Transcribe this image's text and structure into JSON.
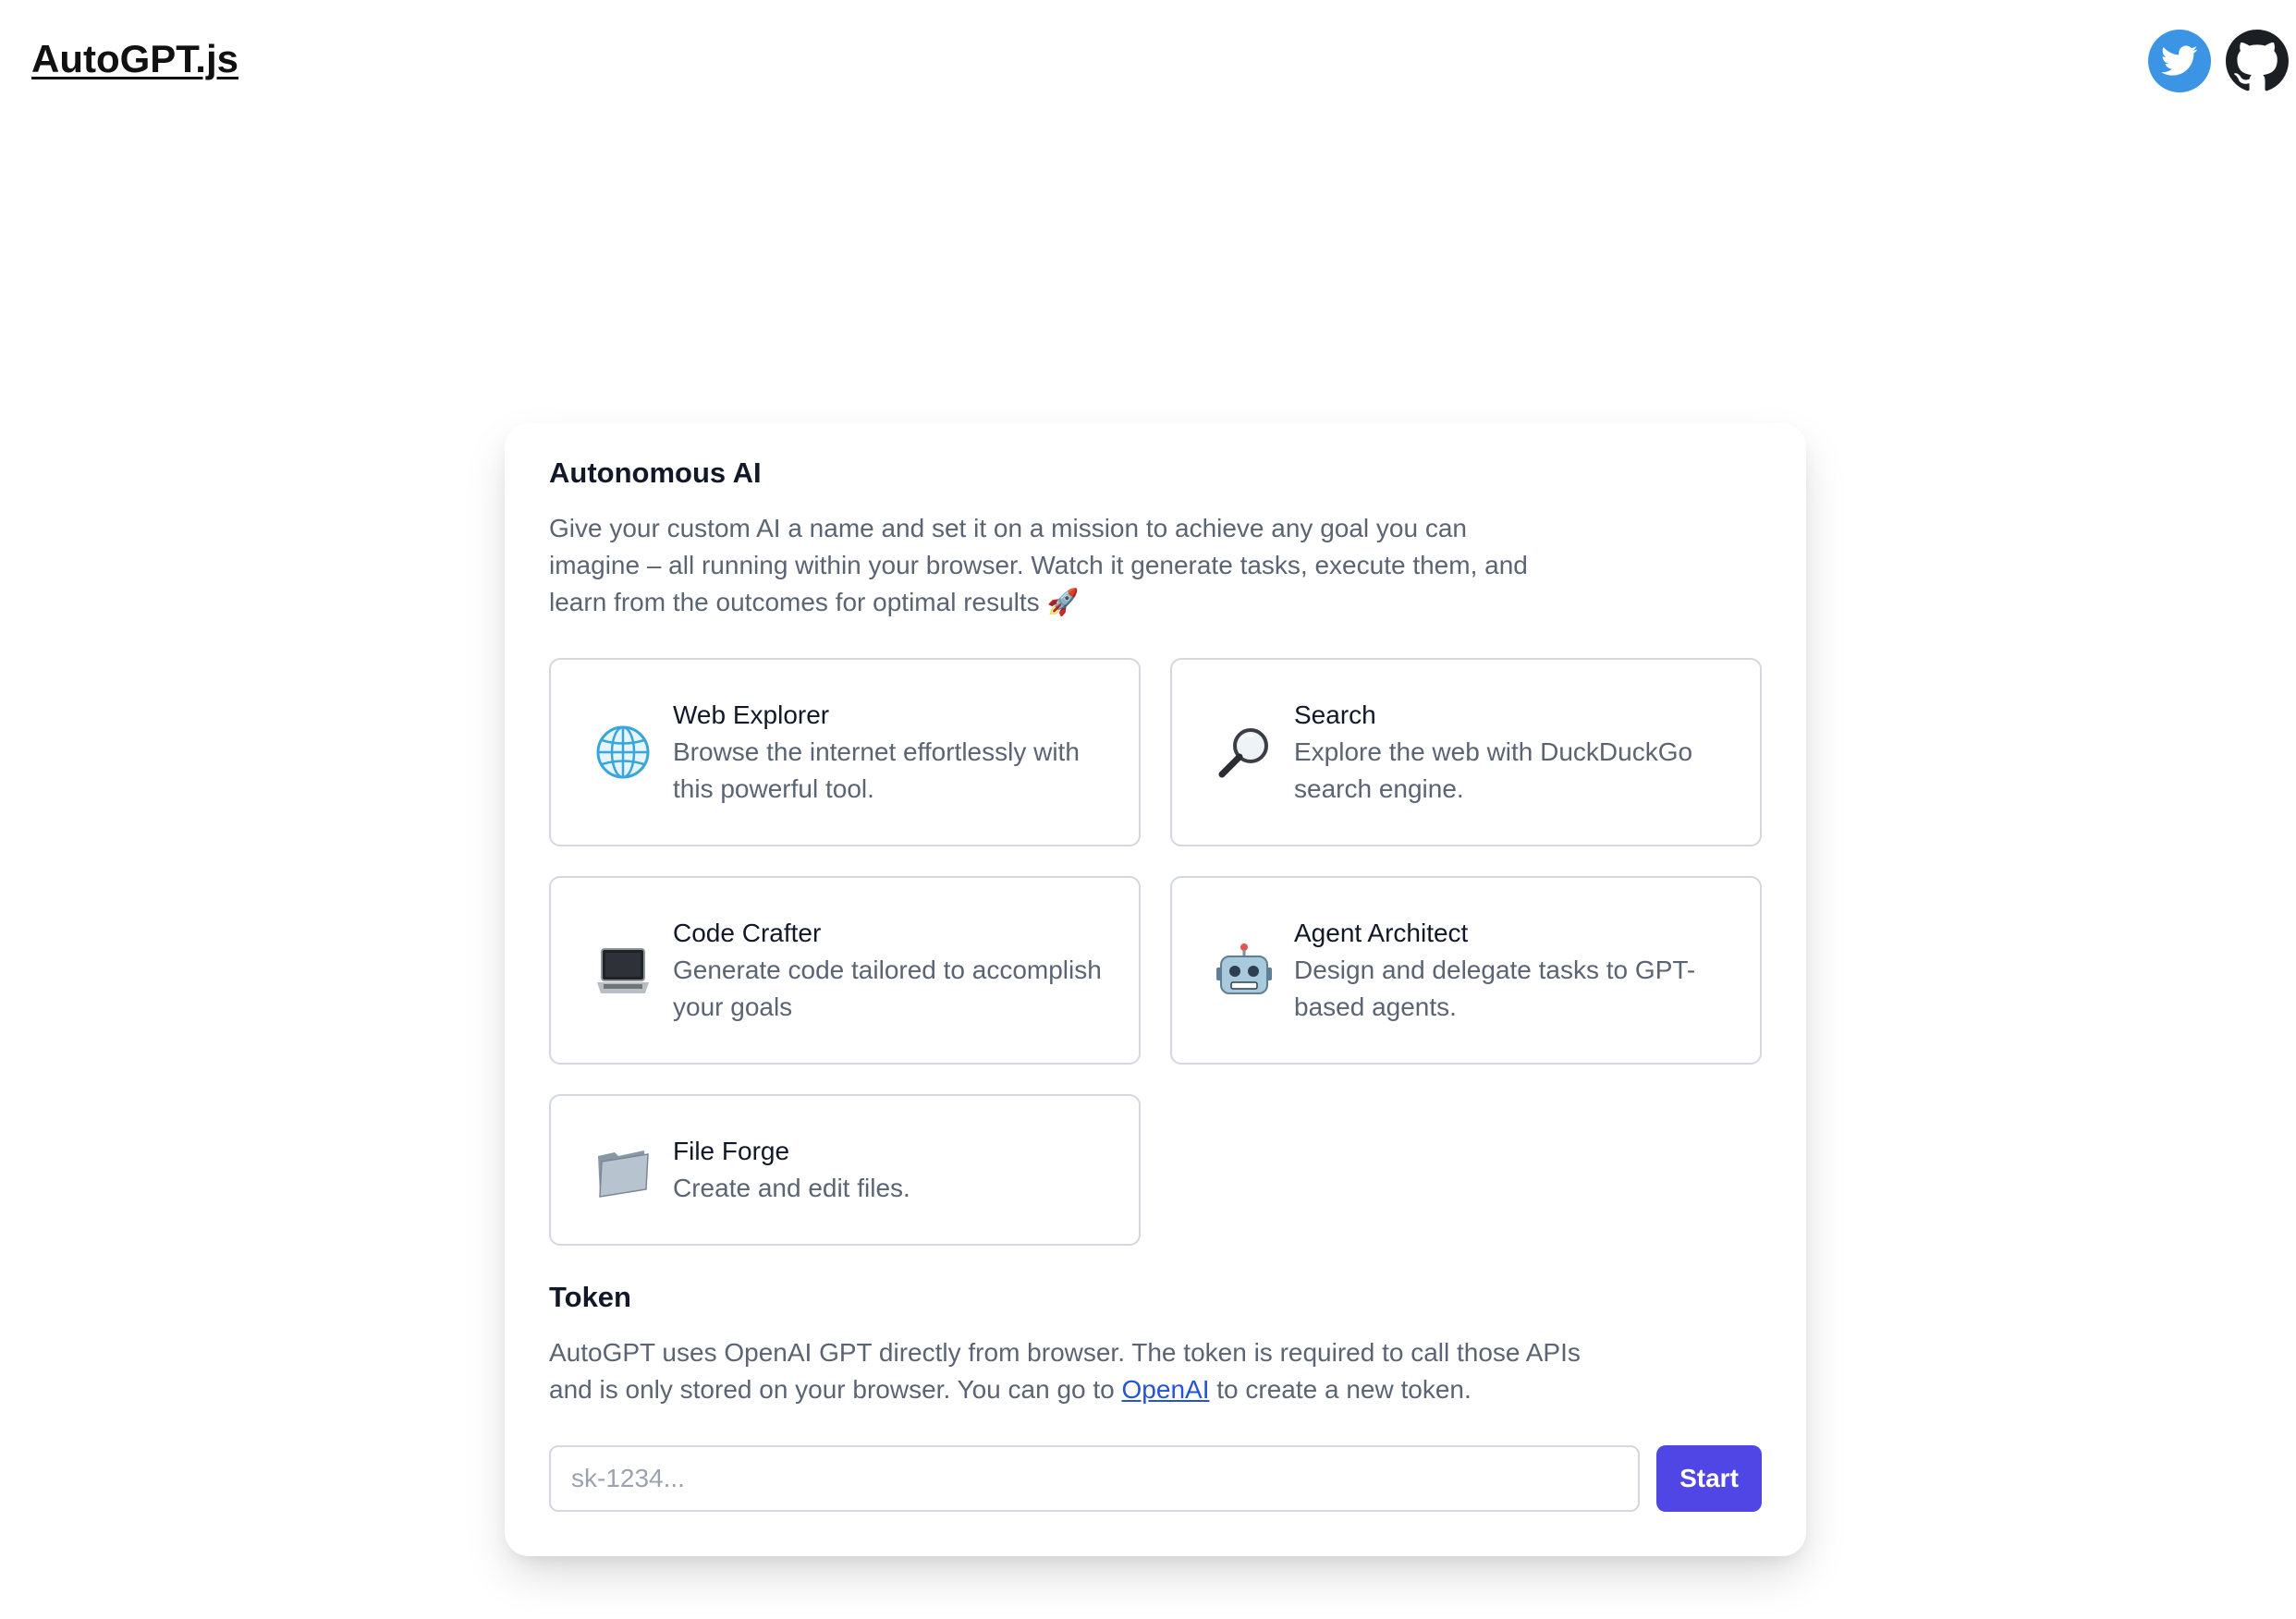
{
  "header": {
    "brand": "AutoGPT.js",
    "social": [
      {
        "name": "twitter-icon",
        "color": "#3b95e4"
      },
      {
        "name": "github-icon",
        "color": "#1b1f23"
      }
    ]
  },
  "intro": {
    "title": "Autonomous AI",
    "description": "Give your custom AI a name and set it on a mission to achieve any goal you can imagine – all running within your browser. Watch it generate tasks, execute them, and learn from the outcomes for optimal results 🚀"
  },
  "tools": [
    {
      "icon": "globe-icon",
      "name": "Web Explorer",
      "description": "Browse the internet effortlessly with this powerful tool."
    },
    {
      "icon": "magnifier-icon",
      "name": "Search",
      "description": "Explore the web with DuckDuckGo search engine."
    },
    {
      "icon": "laptop-icon",
      "name": "Code Crafter",
      "description": "Generate code tailored to accomplish your goals"
    },
    {
      "icon": "robot-icon",
      "name": "Agent Architect",
      "description": "Design and delegate tasks to GPT-based agents."
    },
    {
      "icon": "folder-icon",
      "name": "File Forge",
      "description": "Create and edit files."
    }
  ],
  "token": {
    "title": "Token",
    "description_before": "AutoGPT uses OpenAI GPT directly from browser. The token is required to call those APIs and is only stored on your browser. You can go to ",
    "link_text": "OpenAI",
    "description_after": " to create a new token.",
    "input_value": "",
    "input_placeholder": "sk-1234...",
    "start_label": "Start"
  },
  "colors": {
    "accent": "#4f46e5",
    "link": "#2454d6",
    "border": "#d4d7dd",
    "muted_text": "#5b6473"
  }
}
